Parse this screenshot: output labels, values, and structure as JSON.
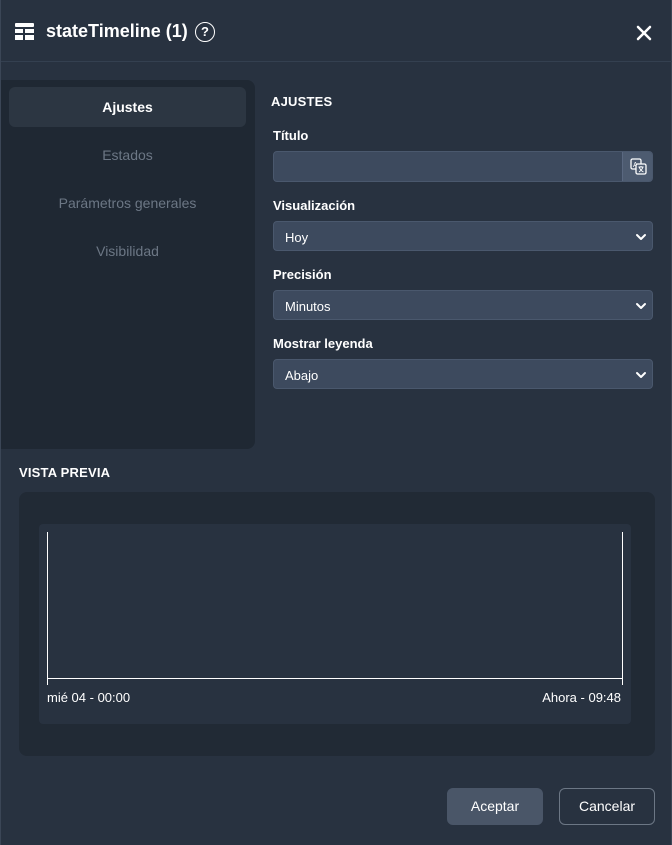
{
  "header": {
    "title": "stateTimeline (1)",
    "widget_icon": "table-widget-icon",
    "help_icon": "question-circle-icon",
    "help_glyph": "?",
    "close_icon": "close-icon"
  },
  "sidebar": {
    "items": [
      {
        "label": "Ajustes",
        "active": true
      },
      {
        "label": "Estados",
        "active": false
      },
      {
        "label": "Parámetros generales",
        "active": false
      },
      {
        "label": "Visibilidad",
        "active": false
      }
    ]
  },
  "settings": {
    "section_title": "AJUSTES",
    "title_field": {
      "label": "Título",
      "value": "",
      "placeholder": "",
      "translate_icon": "translate-icon"
    },
    "visualization": {
      "label": "Visualización",
      "value": "Hoy"
    },
    "precision": {
      "label": "Precisión",
      "value": "Minutos"
    },
    "legend": {
      "label": "Mostrar leyenda",
      "value": "Abajo"
    }
  },
  "preview": {
    "section_title": "VISTA PREVIA",
    "x_start_label": "mié 04 - 00:00",
    "x_end_label": "Ahora - 09:48"
  },
  "footer": {
    "ok_label": "Aceptar",
    "cancel_label": "Cancelar"
  },
  "colors": {
    "background": "#283240",
    "sidebar_bg": "#1f2833",
    "input_bg": "#3d4a5e",
    "muted_text": "#6c7785",
    "text": "#ffffff"
  }
}
